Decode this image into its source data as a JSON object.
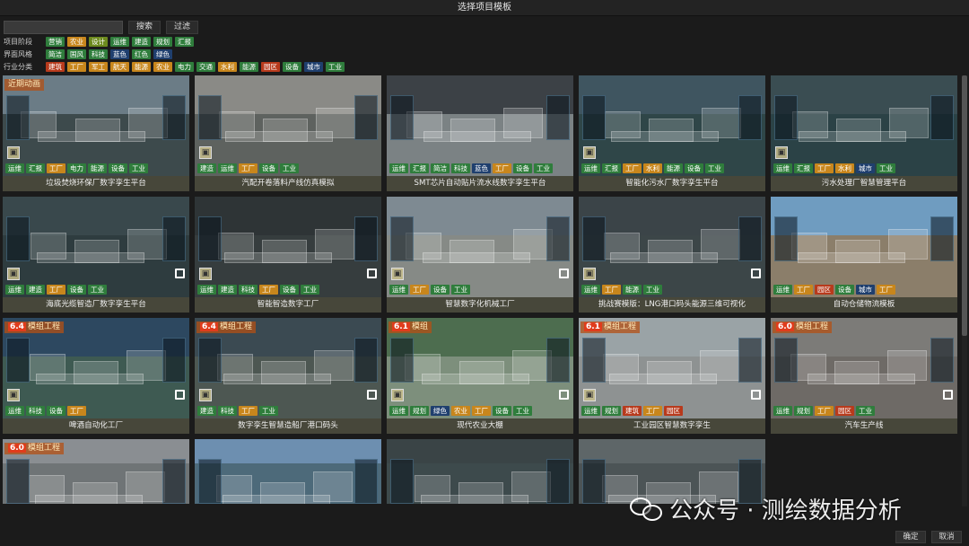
{
  "window": {
    "title": "选择项目模板"
  },
  "search": {
    "placeholder": "",
    "value": "",
    "search_label": "搜索",
    "filter_label": "过滤"
  },
  "filters": [
    {
      "label": "项目阶段",
      "chips": [
        {
          "text": "营销",
          "color": "#2f7d3c"
        },
        {
          "text": "农业",
          "color": "#c8861c"
        },
        {
          "text": "设计",
          "color": "#6d8a1e"
        },
        {
          "text": "运维",
          "color": "#2f7d3c"
        },
        {
          "text": "建造",
          "color": "#2f7d3c"
        },
        {
          "text": "规划",
          "color": "#2f7d3c"
        },
        {
          "text": "汇报",
          "color": "#2f7d3c"
        }
      ]
    },
    {
      "label": "界面风格",
      "chips": [
        {
          "text": "简洁",
          "color": "#2f7d3c"
        },
        {
          "text": "国风",
          "color": "#2f7d3c"
        },
        {
          "text": "科技",
          "color": "#2f7d3c"
        },
        {
          "text": "蓝色",
          "color": "#1f3f6e"
        },
        {
          "text": "红色",
          "color": "#2f7d3c"
        },
        {
          "text": "绿色",
          "color": "#1f3f6e"
        }
      ]
    },
    {
      "label": "行业分类",
      "chips": [
        {
          "text": "建筑",
          "color": "#b83a1c"
        },
        {
          "text": "工厂",
          "color": "#c8861c"
        },
        {
          "text": "军工",
          "color": "#c8861c"
        },
        {
          "text": "航天",
          "color": "#c8861c"
        },
        {
          "text": "能源",
          "color": "#c8861c"
        },
        {
          "text": "农业",
          "color": "#c8861c"
        },
        {
          "text": "电力",
          "color": "#2f7d3c"
        },
        {
          "text": "交通",
          "color": "#2f7d3c"
        },
        {
          "text": "水利",
          "color": "#c8861c"
        },
        {
          "text": "能源",
          "color": "#2f7d3c"
        },
        {
          "text": "园区",
          "color": "#b83a1c"
        },
        {
          "text": "设备",
          "color": "#2f7d3c"
        },
        {
          "text": "城市",
          "color": "#1f3f6e"
        },
        {
          "text": "工业",
          "color": "#2f7d3c"
        }
      ]
    }
  ],
  "cards": [
    {
      "title": "垃圾焚烧环保厂数字孪生平台",
      "ribbon": "",
      "ribbon_num": "",
      "badge": "近期动画",
      "sky": "#6b7c86",
      "ground": "#3d4a4c",
      "fav": true,
      "expand": false,
      "tags": [
        {
          "text": "运维",
          "color": "#2f7d3c"
        },
        {
          "text": "汇报",
          "color": "#2f7d3c"
        },
        {
          "text": "工厂",
          "color": "#c8861c"
        },
        {
          "text": "电力",
          "color": "#2f7d3c"
        },
        {
          "text": "能源",
          "color": "#2f7d3c"
        },
        {
          "text": "设备",
          "color": "#2f7d3c"
        },
        {
          "text": "工业",
          "color": "#2f7d3c"
        }
      ]
    },
    {
      "title": "汽配开卷落料产线仿真模拟",
      "ribbon": "",
      "ribbon_num": "",
      "badge": "",
      "sky": "#8a8a86",
      "ground": "#5e625f",
      "fav": true,
      "expand": false,
      "tags": [
        {
          "text": "建造",
          "color": "#2f7d3c"
        },
        {
          "text": "运维",
          "color": "#2f7d3c"
        },
        {
          "text": "工厂",
          "color": "#c8861c"
        },
        {
          "text": "设备",
          "color": "#2f7d3c"
        },
        {
          "text": "工业",
          "color": "#2f7d3c"
        }
      ]
    },
    {
      "title": "SMT芯片自动贴片流水线数字孪生平台",
      "ribbon": "",
      "ribbon_num": "",
      "badge": "",
      "sky": "#3c4146",
      "ground": "#7b8284",
      "fav": false,
      "expand": false,
      "tags": [
        {
          "text": "运维",
          "color": "#2f7d3c"
        },
        {
          "text": "汇报",
          "color": "#2f7d3c"
        },
        {
          "text": "简洁",
          "color": "#2f7d3c"
        },
        {
          "text": "科技",
          "color": "#2f7d3c"
        },
        {
          "text": "蓝色",
          "color": "#1f3f6e"
        },
        {
          "text": "工厂",
          "color": "#c8861c"
        },
        {
          "text": "设备",
          "color": "#2f7d3c"
        },
        {
          "text": "工业",
          "color": "#2f7d3c"
        }
      ]
    },
    {
      "title": "智能化污水厂数字孪生平台",
      "ribbon": "",
      "ribbon_num": "",
      "badge": "",
      "sky": "#3f5560",
      "ground": "#2f4648",
      "fav": true,
      "expand": false,
      "tags": [
        {
          "text": "运维",
          "color": "#2f7d3c"
        },
        {
          "text": "汇报",
          "color": "#2f7d3c"
        },
        {
          "text": "工厂",
          "color": "#c8861c"
        },
        {
          "text": "水利",
          "color": "#c8861c"
        },
        {
          "text": "能源",
          "color": "#2f7d3c"
        },
        {
          "text": "设备",
          "color": "#2f7d3c"
        },
        {
          "text": "工业",
          "color": "#2f7d3c"
        }
      ]
    },
    {
      "title": "污水处理厂智慧管理平台",
      "ribbon": "",
      "ribbon_num": "",
      "badge": "",
      "sky": "#3a4d52",
      "ground": "#2b4246",
      "fav": true,
      "expand": false,
      "tags": [
        {
          "text": "运维",
          "color": "#2f7d3c"
        },
        {
          "text": "汇报",
          "color": "#2f7d3c"
        },
        {
          "text": "工厂",
          "color": "#c8861c"
        },
        {
          "text": "水利",
          "color": "#c8861c"
        },
        {
          "text": "城市",
          "color": "#1f3f6e"
        },
        {
          "text": "工业",
          "color": "#2f7d3c"
        }
      ]
    },
    {
      "title": "海底光缆智造厂数字孪生平台",
      "ribbon": "",
      "ribbon_num": "",
      "badge": "",
      "sky": "#39484c",
      "ground": "#2e3c3f",
      "fav": true,
      "expand": true,
      "tags": [
        {
          "text": "运维",
          "color": "#2f7d3c"
        },
        {
          "text": "建造",
          "color": "#2f7d3c"
        },
        {
          "text": "工厂",
          "color": "#c8861c"
        },
        {
          "text": "设备",
          "color": "#2f7d3c"
        },
        {
          "text": "工业",
          "color": "#2f7d3c"
        }
      ]
    },
    {
      "title": "智能智造数字工厂",
      "ribbon": "",
      "ribbon_num": "",
      "badge": "",
      "sky": "#2e3436",
      "ground": "#363d3e",
      "fav": true,
      "expand": true,
      "tags": [
        {
          "text": "运维",
          "color": "#2f7d3c"
        },
        {
          "text": "建造",
          "color": "#2f7d3c"
        },
        {
          "text": "科技",
          "color": "#2f7d3c"
        },
        {
          "text": "工厂",
          "color": "#c8861c"
        },
        {
          "text": "设备",
          "color": "#2f7d3c"
        },
        {
          "text": "工业",
          "color": "#2f7d3c"
        }
      ]
    },
    {
      "title": "智慧数字化机械工厂",
      "ribbon": "",
      "ribbon_num": "",
      "badge": "",
      "sky": "#7e8a92",
      "ground": "#868a86",
      "fav": true,
      "expand": true,
      "tags": [
        {
          "text": "运维",
          "color": "#2f7d3c"
        },
        {
          "text": "工厂",
          "color": "#c8861c"
        },
        {
          "text": "设备",
          "color": "#2f7d3c"
        },
        {
          "text": "工业",
          "color": "#2f7d3c"
        }
      ]
    },
    {
      "title": "挑战赛模版：LNG港口码头能源三维可视化",
      "ribbon": "",
      "ribbon_num": "",
      "badge": "",
      "sky": "#3b4448",
      "ground": "#3c4648",
      "fav": true,
      "expand": true,
      "tags": [
        {
          "text": "运维",
          "color": "#2f7d3c"
        },
        {
          "text": "工厂",
          "color": "#c8861c"
        },
        {
          "text": "能源",
          "color": "#2f7d3c"
        },
        {
          "text": "工业",
          "color": "#2f7d3c"
        }
      ]
    },
    {
      "title": "自动仓储物流模板",
      "ribbon": "",
      "ribbon_num": "",
      "badge": "",
      "sky": "#6f9cc0",
      "ground": "#8b7e6a",
      "fav": false,
      "expand": false,
      "tags": [
        {
          "text": "运维",
          "color": "#2f7d3c"
        },
        {
          "text": "工厂",
          "color": "#c8861c"
        },
        {
          "text": "园区",
          "color": "#b83a1c"
        },
        {
          "text": "设备",
          "color": "#2f7d3c"
        },
        {
          "text": "城市",
          "color": "#1f3f6e"
        },
        {
          "text": "工厂",
          "color": "#c8861c"
        }
      ]
    },
    {
      "title": "啤酒自动化工厂",
      "ribbon": "模组工程",
      "ribbon_num": "6.4",
      "badge": "",
      "sky": "#2d4860",
      "ground": "#3e5a52",
      "fav": true,
      "expand": true,
      "tags": [
        {
          "text": "运维",
          "color": "#2f7d3c"
        },
        {
          "text": "科技",
          "color": "#2f7d3c"
        },
        {
          "text": "设备",
          "color": "#2f7d3c"
        },
        {
          "text": "工厂",
          "color": "#c8861c"
        }
      ]
    },
    {
      "title": "数字孪生智慧造船厂港口码头",
      "ribbon": "模组工程",
      "ribbon_num": "6.4",
      "badge": "",
      "sky": "#3b4a52",
      "ground": "#4d5752",
      "fav": true,
      "expand": true,
      "tags": [
        {
          "text": "建造",
          "color": "#2f7d3c"
        },
        {
          "text": "科技",
          "color": "#2f7d3c"
        },
        {
          "text": "工厂",
          "color": "#c8861c"
        },
        {
          "text": "工业",
          "color": "#2f7d3c"
        }
      ]
    },
    {
      "title": "现代农业大棚",
      "ribbon": "模组",
      "ribbon_num": "6.1",
      "badge": "",
      "sky": "#4d6d4f",
      "ground": "#7d8f7c",
      "fav": true,
      "expand": true,
      "tags": [
        {
          "text": "运维",
          "color": "#2f7d3c"
        },
        {
          "text": "规划",
          "color": "#2f7d3c"
        },
        {
          "text": "绿色",
          "color": "#1f3f6e"
        },
        {
          "text": "农业",
          "color": "#c8861c"
        },
        {
          "text": "工厂",
          "color": "#c8861c"
        },
        {
          "text": "设备",
          "color": "#2f7d3c"
        },
        {
          "text": "工业",
          "color": "#2f7d3c"
        }
      ]
    },
    {
      "title": "工业园区智慧数字孪生",
      "ribbon": "模组工程",
      "ribbon_num": "6.1",
      "badge": "",
      "sky": "#9aa3a6",
      "ground": "#8e9292",
      "fav": true,
      "expand": true,
      "tags": [
        {
          "text": "运维",
          "color": "#2f7d3c"
        },
        {
          "text": "规划",
          "color": "#2f7d3c"
        },
        {
          "text": "建筑",
          "color": "#b83a1c"
        },
        {
          "text": "工厂",
          "color": "#c8861c"
        },
        {
          "text": "园区",
          "color": "#b83a1c"
        }
      ]
    },
    {
      "title": "汽车生产线",
      "ribbon": "模组工程",
      "ribbon_num": "6.0",
      "badge": "",
      "sky": "#7c7b78",
      "ground": "#6e6a66",
      "fav": false,
      "expand": true,
      "tags": [
        {
          "text": "运维",
          "color": "#2f7d3c"
        },
        {
          "text": "规划",
          "color": "#2f7d3c"
        },
        {
          "text": "工厂",
          "color": "#c8861c"
        },
        {
          "text": "园区",
          "color": "#b83a1c"
        },
        {
          "text": "工业",
          "color": "#2f7d3c"
        }
      ]
    },
    {
      "title": "",
      "ribbon": "模组工程",
      "ribbon_num": "6.0",
      "badge": "",
      "sky": "#8a8e92",
      "ground": "#6f7476",
      "fav": false,
      "expand": false,
      "tags": []
    },
    {
      "title": "",
      "ribbon": "",
      "ribbon_num": "",
      "badge": "",
      "sky": "#6d8fb0",
      "ground": "#4d6a7a",
      "fav": false,
      "expand": false,
      "tags": []
    },
    {
      "title": "",
      "ribbon": "",
      "ribbon_num": "",
      "badge": "",
      "sky": "#3a4446",
      "ground": "#3d4a4c",
      "fav": false,
      "expand": false,
      "tags": []
    },
    {
      "title": "",
      "ribbon": "",
      "ribbon_num": "",
      "badge": "",
      "sky": "#5e6668",
      "ground": "#4c5456",
      "fav": false,
      "expand": false,
      "tags": []
    }
  ],
  "footer": {
    "confirm_label": "确定",
    "cancel_label": "取消"
  },
  "watermark": {
    "text": "公众号 · 测绘数据分析"
  }
}
